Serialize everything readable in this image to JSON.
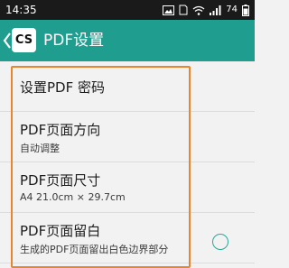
{
  "status_bar": {
    "time": "14:35",
    "battery": "74",
    "icons": [
      "image-icon",
      "sim-icon",
      "wifi-icon",
      "signal-icon",
      "battery-icon"
    ]
  },
  "app_bar": {
    "logo_text": "CS",
    "title": "PDF设置"
  },
  "settings": [
    {
      "title": "设置PDF 密码"
    },
    {
      "title": "PDF页面方向",
      "subtitle": "自动调整"
    },
    {
      "title": "PDF页面尺寸",
      "subtitle": "A4 21.0cm × 29.7cm"
    },
    {
      "title": "PDF页面留白",
      "subtitle": "生成的PDF页面留出白色边界部分",
      "checked": false
    }
  ],
  "colors": {
    "app_bar": "#1f9d8f",
    "status_bar": "#1a1a1a",
    "highlight": "#e8862f",
    "radio": "#2aa89a"
  }
}
